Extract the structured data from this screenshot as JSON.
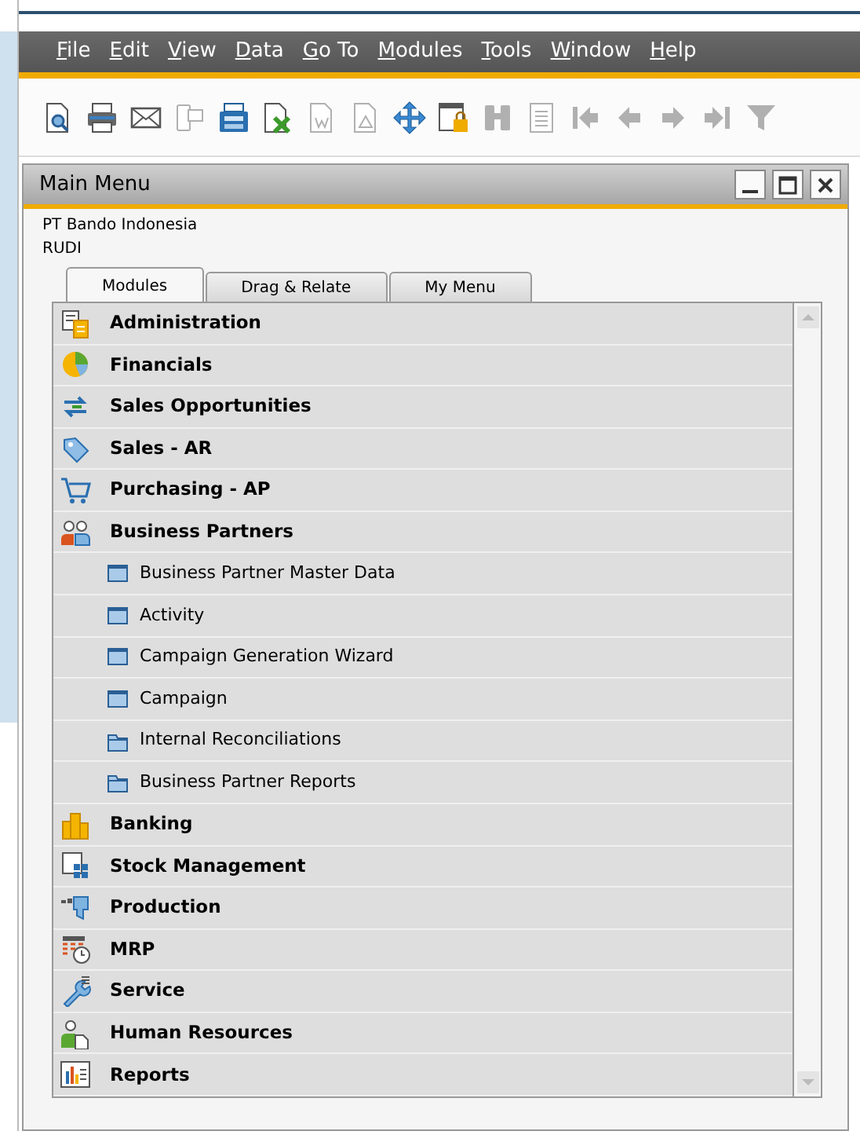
{
  "menu_bar": [
    {
      "label": "File"
    },
    {
      "label": "Edit"
    },
    {
      "label": "View"
    },
    {
      "label": "Data"
    },
    {
      "label": "Go To"
    },
    {
      "label": "Modules"
    },
    {
      "label": "Tools"
    },
    {
      "label": "Window"
    },
    {
      "label": "Help"
    }
  ],
  "toolbar": [
    {
      "kind": "preview",
      "disabled": false
    },
    {
      "kind": "print",
      "disabled": false
    },
    {
      "kind": "email",
      "disabled": false
    },
    {
      "kind": "sms",
      "disabled": true
    },
    {
      "kind": "fax",
      "disabled": false
    },
    {
      "kind": "excel",
      "disabled": false
    },
    {
      "kind": "word",
      "disabled": true
    },
    {
      "kind": "pdf",
      "disabled": true
    },
    {
      "kind": "move",
      "disabled": false
    },
    {
      "kind": "lock",
      "disabled": false
    },
    {
      "kind": "find",
      "disabled": true
    },
    {
      "kind": "list",
      "disabled": true
    },
    {
      "kind": "first",
      "disabled": true
    },
    {
      "kind": "prev",
      "disabled": true
    },
    {
      "kind": "next",
      "disabled": true
    },
    {
      "kind": "last",
      "disabled": true
    },
    {
      "kind": "filter",
      "disabled": true
    }
  ],
  "window": {
    "title": "Main Menu",
    "company": "PT Bando Indonesia",
    "user": "RUDI"
  },
  "tabs": [
    {
      "label": "Modules",
      "selected": true
    },
    {
      "label": "Drag & Relate",
      "selected": false
    },
    {
      "label": "My Menu",
      "selected": false
    }
  ],
  "modules": [
    {
      "label": "Administration",
      "kind": "admin"
    },
    {
      "label": "Financials",
      "kind": "pie"
    },
    {
      "label": "Sales Opportunities",
      "kind": "arrows"
    },
    {
      "label": "Sales - AR",
      "kind": "tag"
    },
    {
      "label": "Purchasing - AP",
      "kind": "cart"
    },
    {
      "label": "Business Partners",
      "kind": "people",
      "expanded": true,
      "children": [
        {
          "label": "Business Partner Master Data",
          "kind": "form"
        },
        {
          "label": "Activity",
          "kind": "form"
        },
        {
          "label": "Campaign Generation Wizard",
          "kind": "form"
        },
        {
          "label": "Campaign",
          "kind": "form"
        },
        {
          "label": "Internal Reconciliations",
          "kind": "folder"
        },
        {
          "label": "Business Partner Reports",
          "kind": "folder"
        }
      ]
    },
    {
      "label": "Banking",
      "kind": "coins"
    },
    {
      "label": "Stock Management",
      "kind": "stock"
    },
    {
      "label": "Production",
      "kind": "production"
    },
    {
      "label": "MRP",
      "kind": "mrp"
    },
    {
      "label": "Service",
      "kind": "wrench"
    },
    {
      "label": "Human Resources",
      "kind": "person"
    },
    {
      "label": "Reports",
      "kind": "chart"
    }
  ]
}
